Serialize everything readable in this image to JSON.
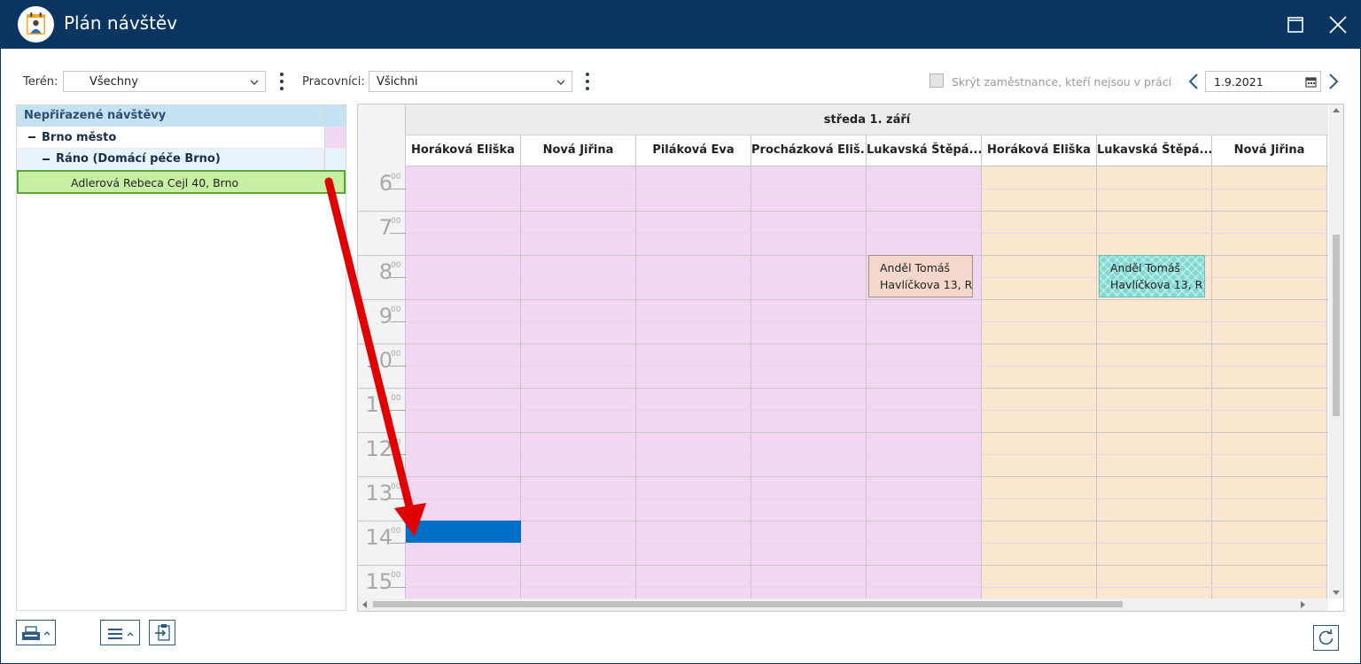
{
  "window": {
    "title": "Plán návštěv"
  },
  "filters": {
    "teren_label": "Terén:",
    "teren_value": "Všechny",
    "pracovnici_label": "Pracovníci:",
    "pracovnici_value": "Všichni",
    "hide_label": "Skrýt zaměstnance, kteří nejsou v práci",
    "hide_checked": false,
    "date_value": "1.9.2021"
  },
  "tree": {
    "header": "Nepřiřazené návštěvy",
    "group1": "Brno město",
    "group2": "Ráno (Domácí péče Brno)",
    "item": "Adlerová Rebeca Cejl 40, Brno"
  },
  "calendar": {
    "day_title": "středa 1. září",
    "staff": [
      "Horáková Eliška",
      "Nová Jiřina",
      "Piláková Eva",
      "Procházková Eliš...",
      "Lukavská Štěpá...",
      "Horáková Eliška",
      "Lukavská Štěpá...",
      "Nová Jiřina"
    ],
    "hours": [
      {
        "h": "6",
        "m": "00"
      },
      {
        "h": "7",
        "m": "00"
      },
      {
        "h": "8",
        "m": "00"
      },
      {
        "h": "9",
        "m": "00"
      },
      {
        "h": "10",
        "m": "00"
      },
      {
        "h": "11",
        "m": "00"
      },
      {
        "h": "12",
        "m": "00"
      },
      {
        "h": "13",
        "m": "00"
      },
      {
        "h": "14",
        "m": "00"
      },
      {
        "h": "15",
        "m": "00"
      }
    ],
    "events": [
      {
        "line1": "Anděl Tomáš",
        "line2": "Havlíčkova 13, R"
      },
      {
        "line1": "Anděl Tomáš",
        "line2": "Havlíčkova 13, R"
      }
    ]
  },
  "colors": {
    "titlebar": "#0a3561",
    "group_pink": "#f2d6f2",
    "group_peach": "#fbe6d0",
    "selected_item": "#c8f0a4",
    "drop_target": "#0070c6",
    "arrow": "#e00000"
  },
  "icons": {
    "app": "calendar-person-icon",
    "maximize": "maximize-icon",
    "close": "close-icon",
    "print": "printer-icon",
    "menu": "hamburger-menu-icon",
    "export": "export-clipboard-icon",
    "refresh": "refresh-icon"
  }
}
